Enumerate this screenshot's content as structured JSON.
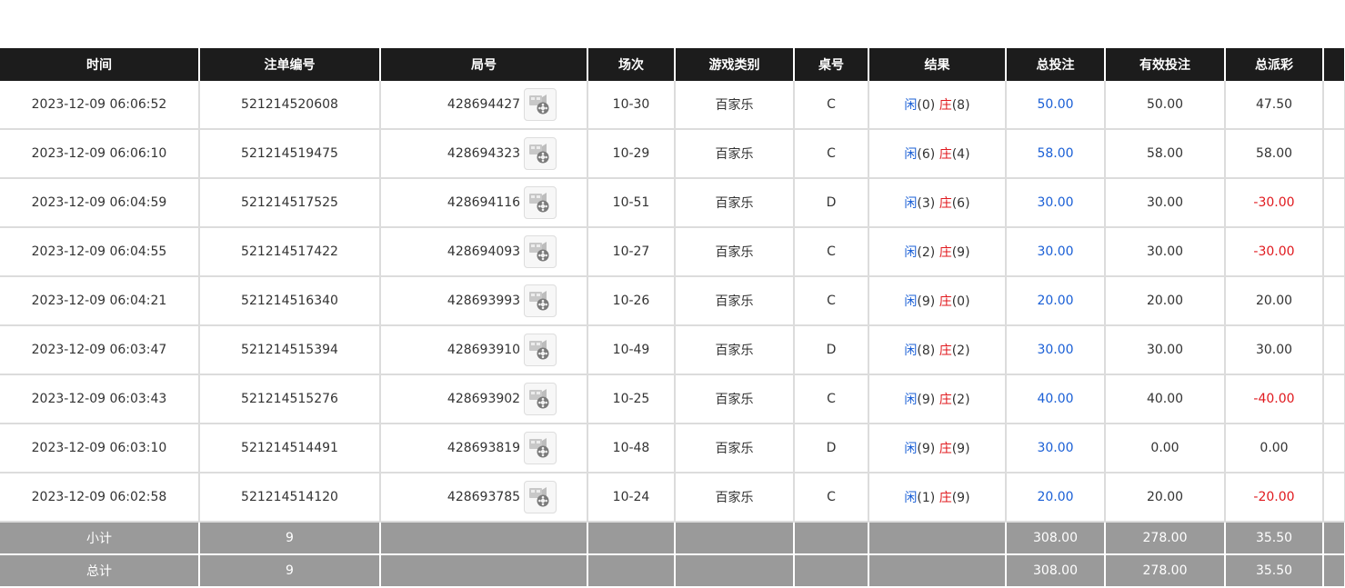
{
  "table": {
    "headers": [
      "时间",
      "注单编号",
      "局号",
      "场次",
      "游戏类别",
      "桌号",
      "结果",
      "总投注",
      "有效投注",
      "总派彩"
    ],
    "rows": [
      {
        "time": "2023-12-09 06:06:52",
        "bet_id": "521214520608",
        "round": "428694427",
        "session": "10-30",
        "game": "百家乐",
        "table_no": "C",
        "player_label": "闲",
        "player_value": "(0)",
        "banker_label": "庄",
        "banker_value": "(8)",
        "total_bet": "50.00",
        "valid_bet": "50.00",
        "payout": "47.50",
        "payout_negative": false
      },
      {
        "time": "2023-12-09 06:06:10",
        "bet_id": "521214519475",
        "round": "428694323",
        "session": "10-29",
        "game": "百家乐",
        "table_no": "C",
        "player_label": "闲",
        "player_value": "(6)",
        "banker_label": "庄",
        "banker_value": "(4)",
        "total_bet": "58.00",
        "valid_bet": "58.00",
        "payout": "58.00",
        "payout_negative": false
      },
      {
        "time": "2023-12-09 06:04:59",
        "bet_id": "521214517525",
        "round": "428694116",
        "session": "10-51",
        "game": "百家乐",
        "table_no": "D",
        "player_label": "闲",
        "player_value": "(3)",
        "banker_label": "庄",
        "banker_value": "(6)",
        "total_bet": "30.00",
        "valid_bet": "30.00",
        "payout": "-30.00",
        "payout_negative": true
      },
      {
        "time": "2023-12-09 06:04:55",
        "bet_id": "521214517422",
        "round": "428694093",
        "session": "10-27",
        "game": "百家乐",
        "table_no": "C",
        "player_label": "闲",
        "player_value": "(2)",
        "banker_label": "庄",
        "banker_value": "(9)",
        "total_bet": "30.00",
        "valid_bet": "30.00",
        "payout": "-30.00",
        "payout_negative": true
      },
      {
        "time": "2023-12-09 06:04:21",
        "bet_id": "521214516340",
        "round": "428693993",
        "session": "10-26",
        "game": "百家乐",
        "table_no": "C",
        "player_label": "闲",
        "player_value": "(9)",
        "banker_label": "庄",
        "banker_value": "(0)",
        "total_bet": "20.00",
        "valid_bet": "20.00",
        "payout": "20.00",
        "payout_negative": false
      },
      {
        "time": "2023-12-09 06:03:47",
        "bet_id": "521214515394",
        "round": "428693910",
        "session": "10-49",
        "game": "百家乐",
        "table_no": "D",
        "player_label": "闲",
        "player_value": "(8)",
        "banker_label": "庄",
        "banker_value": "(2)",
        "total_bet": "30.00",
        "valid_bet": "30.00",
        "payout": "30.00",
        "payout_negative": false
      },
      {
        "time": "2023-12-09 06:03:43",
        "bet_id": "521214515276",
        "round": "428693902",
        "session": "10-25",
        "game": "百家乐",
        "table_no": "C",
        "player_label": "闲",
        "player_value": "(9)",
        "banker_label": "庄",
        "banker_value": "(2)",
        "total_bet": "40.00",
        "valid_bet": "40.00",
        "payout": "-40.00",
        "payout_negative": true
      },
      {
        "time": "2023-12-09 06:03:10",
        "bet_id": "521214514491",
        "round": "428693819",
        "session": "10-48",
        "game": "百家乐",
        "table_no": "D",
        "player_label": "闲",
        "player_value": "(9)",
        "banker_label": "庄",
        "banker_value": "(9)",
        "total_bet": "30.00",
        "valid_bet": "0.00",
        "payout": "0.00",
        "payout_negative": false
      },
      {
        "time": "2023-12-09 06:02:58",
        "bet_id": "521214514120",
        "round": "428693785",
        "session": "10-24",
        "game": "百家乐",
        "table_no": "C",
        "player_label": "闲",
        "player_value": "(1)",
        "banker_label": "庄",
        "banker_value": "(9)",
        "total_bet": "20.00",
        "valid_bet": "20.00",
        "payout": "-20.00",
        "payout_negative": true
      }
    ],
    "subtotal": {
      "label": "小计",
      "count": "9",
      "total_bet": "308.00",
      "valid_bet": "278.00",
      "payout": "35.50"
    },
    "total": {
      "label": "总计",
      "count": "9",
      "total_bet": "308.00",
      "valid_bet": "278.00",
      "payout": "35.50"
    }
  },
  "icons": {
    "replay": "video-replay-icon"
  },
  "colors": {
    "header_bg": "#1c1c1c",
    "total_row_bg": "#9a9a9a",
    "bet_blue": "#1a5fd6",
    "negative_red": "#e0191e"
  }
}
